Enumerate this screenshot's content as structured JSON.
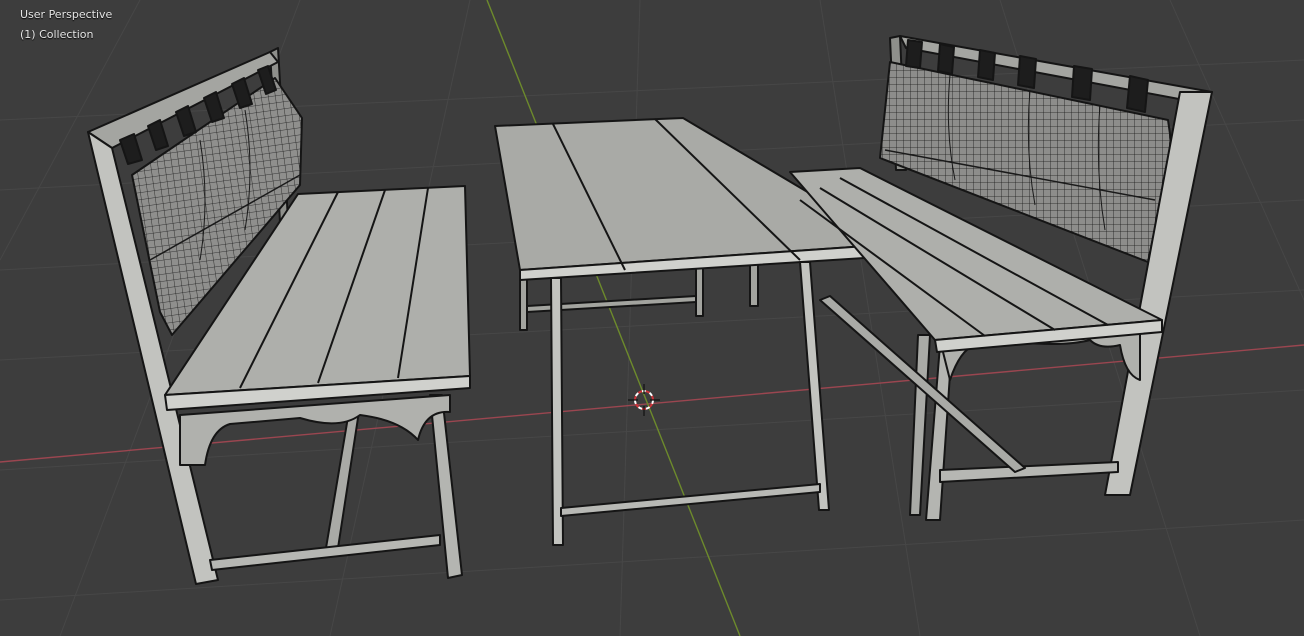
{
  "viewport": {
    "view_label": "User Perspective",
    "collection_label": "(1) Collection",
    "background_color": "#3d3d3d"
  },
  "axes": {
    "x_axis_color": "#9b4650",
    "y_axis_color": "#6d8a2c"
  },
  "objects": [
    "left-bench",
    "table",
    "right-bench"
  ],
  "materials": {
    "wood": "#a9aaa6",
    "wood_light": "#c7c8c4",
    "wood_dark": "#7f807c",
    "edge": "#151515",
    "cushion": "#8a8a88",
    "strap": "#1d1d1d"
  }
}
